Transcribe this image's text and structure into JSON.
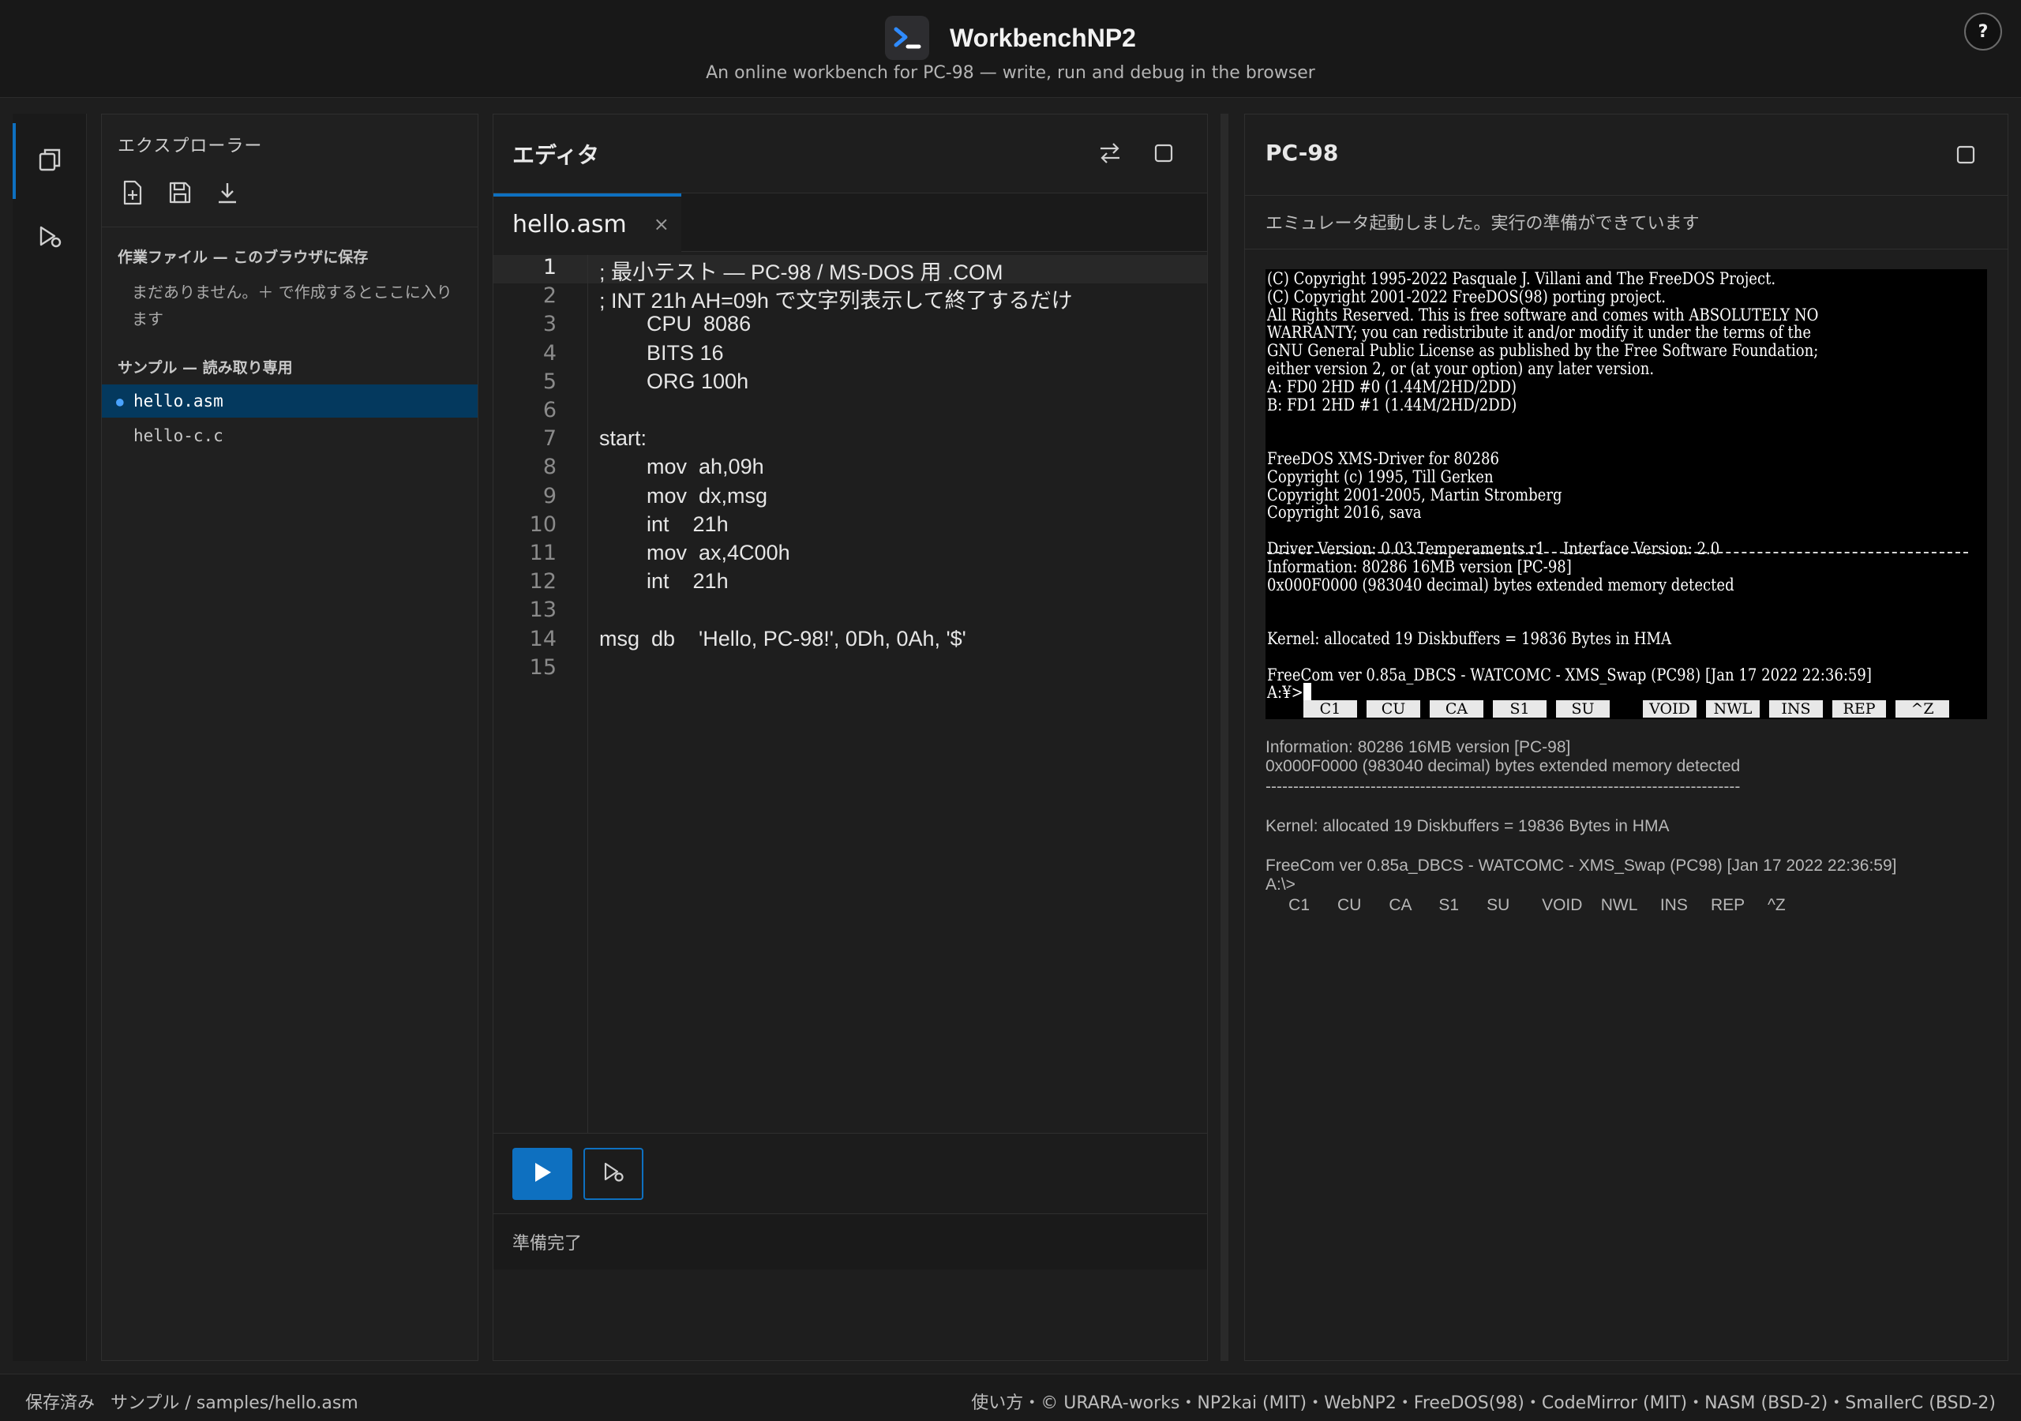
{
  "header": {
    "title": "WorkbenchNP2",
    "subtitle": "An online workbench for PC-98 — write, run and debug in the browser",
    "help_label": "?",
    "logo_icon": "terminal-prompt-icon",
    "accent": "#0e70c0"
  },
  "activity_bar": {
    "items": [
      {
        "icon": "files-icon",
        "active": true
      },
      {
        "icon": "run-debug-icon",
        "active": false
      }
    ]
  },
  "explorer": {
    "title": "エクスプローラー",
    "tools": [
      "new-file-icon",
      "save-icon",
      "download-icon"
    ],
    "work_section_label": "作業ファイル — このブラウザに保存",
    "empty_message": "まだありません。＋ で作成するとここに入ります",
    "samples_section_label": "サンプル — 読み取り専用",
    "samples": [
      {
        "name": "hello.asm",
        "selected": true
      },
      {
        "name": "hello-c.c",
        "selected": false
      }
    ]
  },
  "editor": {
    "title": "エディタ",
    "tab": {
      "label": "hello.asm",
      "close": "×"
    },
    "active_line": 1,
    "lines": [
      "; 最小テスト — PC-98 / MS-DOS 用 .COM",
      "; INT 21h AH=09h で文字列表示して終了するだけ",
      "        CPU  8086",
      "        BITS 16",
      "        ORG 100h",
      "",
      "start:",
      "        mov  ah,09h",
      "        mov  dx,msg",
      "        int    21h",
      "        mov  ax,4C00h",
      "        int    21h",
      "",
      "msg  db    'Hello, PC-98!', 0Dh, 0Ah, '$'",
      ""
    ],
    "status": "準備完了"
  },
  "pc98": {
    "title": "PC-98",
    "status": "エミュレータ起動しました。実行の準備ができています",
    "screen_lines": [
      "(C) Copyright 1995-2022 Pasquale J. Villani and The FreeDOS Project.",
      "(C) Copyright 2001-2022 FreeDOS(98) porting project.",
      "All Rights Reserved. This is free software and comes with ABSOLUTELY NO",
      "WARRANTY; you can redistribute it and/or modify it under the terms of the",
      "GNU General Public License as published by the Free Software Foundation;",
      "either version 2, or (at your option) any later version.",
      "A: FD0 2HD #0 (1.44M/2HD/2DD)",
      "B: FD1 2HD #1 (1.44M/2HD/2DD)",
      "",
      "",
      "FreeDOS XMS-Driver for 80286",
      "Copyright (c) 1995, Till Gerken",
      "Copyright 2001-2005, Martin Stromberg",
      "Copyright 2016, sava",
      "",
      "Driver Version: 0.03.Temperaments.r1    Interface Version: 2.0",
      "Information: 80286 16MB version [PC-98]",
      "0x000F0000 (983040 decimal) bytes extended memory detected",
      "",
      "",
      "Kernel: allocated 19 Diskbuffers = 19836 Bytes in HMA",
      "",
      "FreeCom ver 0.85a_DBCS - WATCOMC - XMS_Swap (PC98) [Jan 17 2022 22:36:59]",
      "A:¥>"
    ],
    "fkeys": [
      "C1",
      "CU",
      "CA",
      "S1",
      "SU",
      "VOID",
      "NWL",
      "INS",
      "REP",
      "^Z"
    ],
    "log_lines": [
      "Information: 80286 16MB version [PC-98]",
      "0x000F0000 (983040 decimal) bytes extended memory detected",
      "--------------------------------------------------------------------------------------",
      "",
      "Kernel: allocated 19 Diskbuffers = 19836 Bytes in HMA",
      "",
      "FreeCom ver 0.85a_DBCS - WATCOMC - XMS_Swap (PC98) [Jan 17 2022 22:36:59]",
      "A:\\>",
      "     C1      CU      CA      S1      SU       VOID    NWL     INS     REP     ^Z"
    ]
  },
  "statusbar": {
    "save_state": "保存済み",
    "path": "サンプル / samples/hello.asm",
    "credits": "使い方・© URARA-works・NP2kai (MIT)・WebNP2・FreeDOS(98)・CodeMirror (MIT)・NASM (BSD-2)・SmallerC (BSD-2)"
  }
}
